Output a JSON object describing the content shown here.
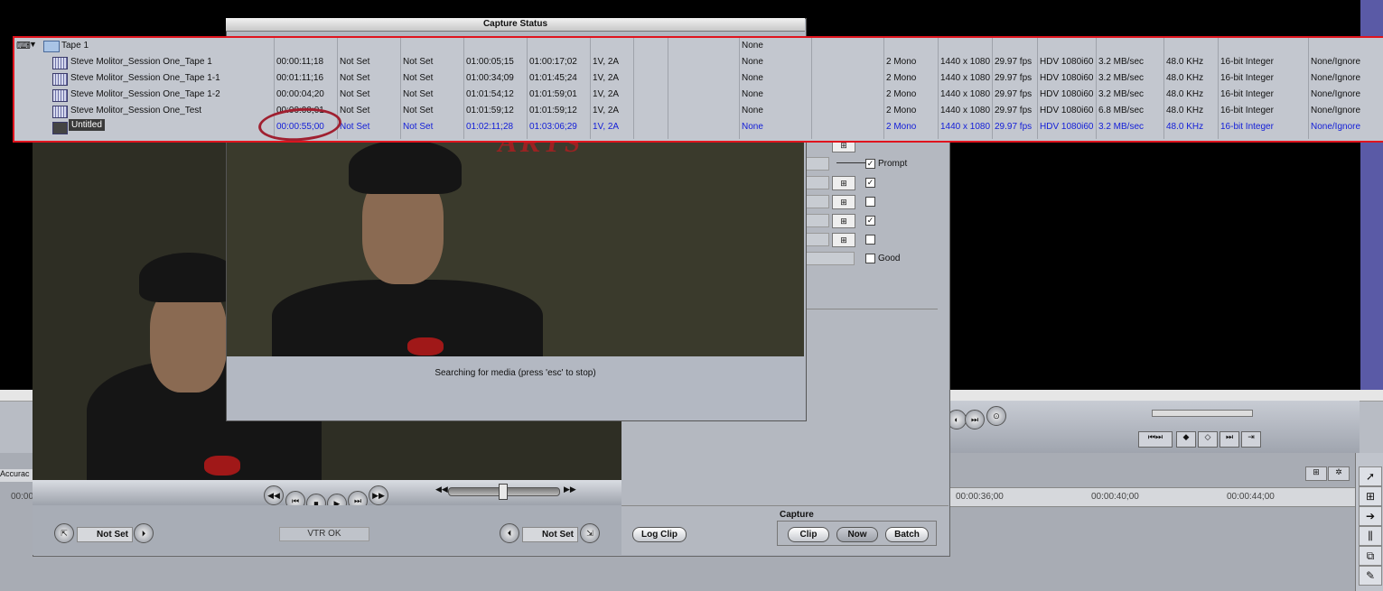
{
  "capture_status": {
    "title": "Capture Status",
    "message": "Searching for media (press 'esc' to stop)",
    "video_text": "ARTS"
  },
  "browser": {
    "bin_label": "Tape 1",
    "bin_column_value": "None",
    "rows": [
      {
        "name": "Steve Molitor_Session One_Tape 1",
        "dur": "00:00:11;18",
        "in": "Not Set",
        "out": "Not Set",
        "mstart": "01:00:05;15",
        "mend": "01:00:17;02",
        "tracks": "1V, 2A",
        "good": "None",
        "aud": "2 Mono",
        "frame": "1440 x 1080",
        "rate": "29.97 fps",
        "comp": "HDV 1080i60",
        "datarate": "3.2 MB/sec",
        "arate": "48.0 KHz",
        "aformat": "16-bit Integer",
        "alpha": "None/Ignore"
      },
      {
        "name": "Steve Molitor_Session One_Tape 1-1",
        "dur": "00:01:11;16",
        "in": "Not Set",
        "out": "Not Set",
        "mstart": "01:00:34;09",
        "mend": "01:01:45;24",
        "tracks": "1V, 2A",
        "good": "None",
        "aud": "2 Mono",
        "frame": "1440 x 1080",
        "rate": "29.97 fps",
        "comp": "HDV 1080i60",
        "datarate": "3.2 MB/sec",
        "arate": "48.0 KHz",
        "aformat": "16-bit Integer",
        "alpha": "None/Ignore"
      },
      {
        "name": "Steve Molitor_Session One_Tape 1-2",
        "dur": "00:00:04;20",
        "in": "Not Set",
        "out": "Not Set",
        "mstart": "01:01:54;12",
        "mend": "01:01:59;01",
        "tracks": "1V, 2A",
        "good": "None",
        "aud": "2 Mono",
        "frame": "1440 x 1080",
        "rate": "29.97 fps",
        "comp": "HDV 1080i60",
        "datarate": "3.2 MB/sec",
        "arate": "48.0 KHz",
        "aformat": "16-bit Integer",
        "alpha": "None/Ignore"
      },
      {
        "name": "Steve Molitor_Session One_Test",
        "dur": "00:00:00;01",
        "in": "Not Set",
        "out": "Not Set",
        "mstart": "01:01:59;12",
        "mend": "01:01:59;12",
        "tracks": "1V, 2A",
        "good": "None",
        "aud": "2 Mono",
        "frame": "1440 x 1080",
        "rate": "29.97 fps",
        "comp": "HDV 1080i60",
        "datarate": "6.8 MB/sec",
        "arate": "48.0 KHz",
        "aformat": "16-bit Integer",
        "alpha": "None/Ignore"
      },
      {
        "name": "Untitled",
        "dur": "00:00:55;00",
        "in": "Not Set",
        "out": "Not Set",
        "mstart": "01:02:11;28",
        "mend": "01:03:06;29",
        "tracks": "1V, 2A",
        "good": "None",
        "aud": "2 Mono",
        "frame": "1440 x 1080",
        "rate": "29.97 fps",
        "comp": "HDV 1080i60",
        "datarate": "3.2 MB/sec",
        "arate": "48.0 KHz",
        "aformat": "16-bit Integer",
        "alpha": "None/Ignore"
      }
    ]
  },
  "log_capture": {
    "prompt_label": "Prompt",
    "good_label": "Good",
    "in_point": "Not Set",
    "out_point": "Not Set",
    "vtr_status": "VTR OK",
    "log_clip_label": "Log Clip",
    "capture_header": "Capture",
    "capture_clip_label": "Clip",
    "capture_now_label": "Now",
    "capture_batch_label": "Batch"
  },
  "timeline": {
    "tab_label": "Accurac",
    "ticks": [
      "00:00:36;00",
      "00:00:40;00",
      "00:00:44;00"
    ],
    "left_tick": "00:00"
  },
  "colors": {
    "highlight_border": "#e0141e",
    "selected_row_text": "#1520d8",
    "annotation_circle": "#a02030"
  }
}
